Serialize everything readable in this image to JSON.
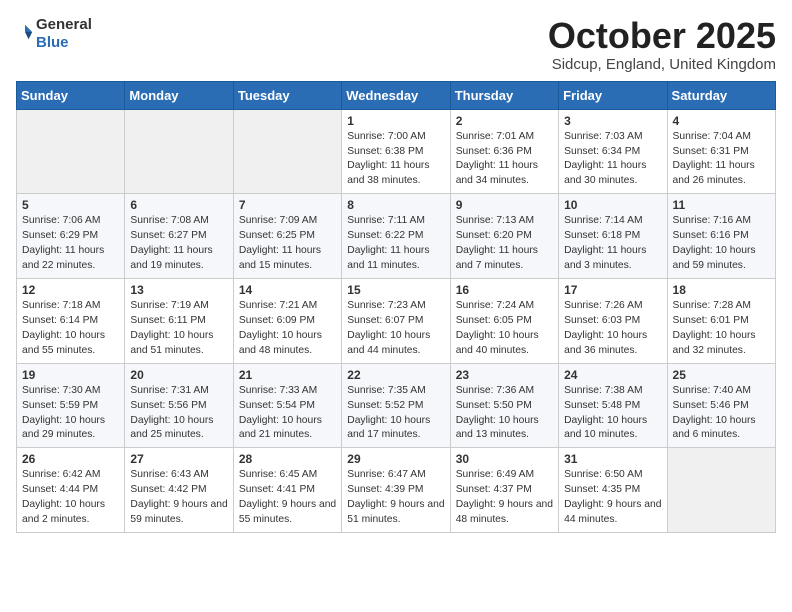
{
  "header": {
    "logo_general": "General",
    "logo_blue": "Blue",
    "month_title": "October 2025",
    "location": "Sidcup, England, United Kingdom"
  },
  "weekdays": [
    "Sunday",
    "Monday",
    "Tuesday",
    "Wednesday",
    "Thursday",
    "Friday",
    "Saturday"
  ],
  "weeks": [
    [
      {
        "day": "",
        "sunrise": "",
        "sunset": "",
        "daylight": ""
      },
      {
        "day": "",
        "sunrise": "",
        "sunset": "",
        "daylight": ""
      },
      {
        "day": "",
        "sunrise": "",
        "sunset": "",
        "daylight": ""
      },
      {
        "day": "1",
        "sunrise": "Sunrise: 7:00 AM",
        "sunset": "Sunset: 6:38 PM",
        "daylight": "Daylight: 11 hours and 38 minutes."
      },
      {
        "day": "2",
        "sunrise": "Sunrise: 7:01 AM",
        "sunset": "Sunset: 6:36 PM",
        "daylight": "Daylight: 11 hours and 34 minutes."
      },
      {
        "day": "3",
        "sunrise": "Sunrise: 7:03 AM",
        "sunset": "Sunset: 6:34 PM",
        "daylight": "Daylight: 11 hours and 30 minutes."
      },
      {
        "day": "4",
        "sunrise": "Sunrise: 7:04 AM",
        "sunset": "Sunset: 6:31 PM",
        "daylight": "Daylight: 11 hours and 26 minutes."
      }
    ],
    [
      {
        "day": "5",
        "sunrise": "Sunrise: 7:06 AM",
        "sunset": "Sunset: 6:29 PM",
        "daylight": "Daylight: 11 hours and 22 minutes."
      },
      {
        "day": "6",
        "sunrise": "Sunrise: 7:08 AM",
        "sunset": "Sunset: 6:27 PM",
        "daylight": "Daylight: 11 hours and 19 minutes."
      },
      {
        "day": "7",
        "sunrise": "Sunrise: 7:09 AM",
        "sunset": "Sunset: 6:25 PM",
        "daylight": "Daylight: 11 hours and 15 minutes."
      },
      {
        "day": "8",
        "sunrise": "Sunrise: 7:11 AM",
        "sunset": "Sunset: 6:22 PM",
        "daylight": "Daylight: 11 hours and 11 minutes."
      },
      {
        "day": "9",
        "sunrise": "Sunrise: 7:13 AM",
        "sunset": "Sunset: 6:20 PM",
        "daylight": "Daylight: 11 hours and 7 minutes."
      },
      {
        "day": "10",
        "sunrise": "Sunrise: 7:14 AM",
        "sunset": "Sunset: 6:18 PM",
        "daylight": "Daylight: 11 hours and 3 minutes."
      },
      {
        "day": "11",
        "sunrise": "Sunrise: 7:16 AM",
        "sunset": "Sunset: 6:16 PM",
        "daylight": "Daylight: 10 hours and 59 minutes."
      }
    ],
    [
      {
        "day": "12",
        "sunrise": "Sunrise: 7:18 AM",
        "sunset": "Sunset: 6:14 PM",
        "daylight": "Daylight: 10 hours and 55 minutes."
      },
      {
        "day": "13",
        "sunrise": "Sunrise: 7:19 AM",
        "sunset": "Sunset: 6:11 PM",
        "daylight": "Daylight: 10 hours and 51 minutes."
      },
      {
        "day": "14",
        "sunrise": "Sunrise: 7:21 AM",
        "sunset": "Sunset: 6:09 PM",
        "daylight": "Daylight: 10 hours and 48 minutes."
      },
      {
        "day": "15",
        "sunrise": "Sunrise: 7:23 AM",
        "sunset": "Sunset: 6:07 PM",
        "daylight": "Daylight: 10 hours and 44 minutes."
      },
      {
        "day": "16",
        "sunrise": "Sunrise: 7:24 AM",
        "sunset": "Sunset: 6:05 PM",
        "daylight": "Daylight: 10 hours and 40 minutes."
      },
      {
        "day": "17",
        "sunrise": "Sunrise: 7:26 AM",
        "sunset": "Sunset: 6:03 PM",
        "daylight": "Daylight: 10 hours and 36 minutes."
      },
      {
        "day": "18",
        "sunrise": "Sunrise: 7:28 AM",
        "sunset": "Sunset: 6:01 PM",
        "daylight": "Daylight: 10 hours and 32 minutes."
      }
    ],
    [
      {
        "day": "19",
        "sunrise": "Sunrise: 7:30 AM",
        "sunset": "Sunset: 5:59 PM",
        "daylight": "Daylight: 10 hours and 29 minutes."
      },
      {
        "day": "20",
        "sunrise": "Sunrise: 7:31 AM",
        "sunset": "Sunset: 5:56 PM",
        "daylight": "Daylight: 10 hours and 25 minutes."
      },
      {
        "day": "21",
        "sunrise": "Sunrise: 7:33 AM",
        "sunset": "Sunset: 5:54 PM",
        "daylight": "Daylight: 10 hours and 21 minutes."
      },
      {
        "day": "22",
        "sunrise": "Sunrise: 7:35 AM",
        "sunset": "Sunset: 5:52 PM",
        "daylight": "Daylight: 10 hours and 17 minutes."
      },
      {
        "day": "23",
        "sunrise": "Sunrise: 7:36 AM",
        "sunset": "Sunset: 5:50 PM",
        "daylight": "Daylight: 10 hours and 13 minutes."
      },
      {
        "day": "24",
        "sunrise": "Sunrise: 7:38 AM",
        "sunset": "Sunset: 5:48 PM",
        "daylight": "Daylight: 10 hours and 10 minutes."
      },
      {
        "day": "25",
        "sunrise": "Sunrise: 7:40 AM",
        "sunset": "Sunset: 5:46 PM",
        "daylight": "Daylight: 10 hours and 6 minutes."
      }
    ],
    [
      {
        "day": "26",
        "sunrise": "Sunrise: 6:42 AM",
        "sunset": "Sunset: 4:44 PM",
        "daylight": "Daylight: 10 hours and 2 minutes."
      },
      {
        "day": "27",
        "sunrise": "Sunrise: 6:43 AM",
        "sunset": "Sunset: 4:42 PM",
        "daylight": "Daylight: 9 hours and 59 minutes."
      },
      {
        "day": "28",
        "sunrise": "Sunrise: 6:45 AM",
        "sunset": "Sunset: 4:41 PM",
        "daylight": "Daylight: 9 hours and 55 minutes."
      },
      {
        "day": "29",
        "sunrise": "Sunrise: 6:47 AM",
        "sunset": "Sunset: 4:39 PM",
        "daylight": "Daylight: 9 hours and 51 minutes."
      },
      {
        "day": "30",
        "sunrise": "Sunrise: 6:49 AM",
        "sunset": "Sunset: 4:37 PM",
        "daylight": "Daylight: 9 hours and 48 minutes."
      },
      {
        "day": "31",
        "sunrise": "Sunrise: 6:50 AM",
        "sunset": "Sunset: 4:35 PM",
        "daylight": "Daylight: 9 hours and 44 minutes."
      },
      {
        "day": "",
        "sunrise": "",
        "sunset": "",
        "daylight": ""
      }
    ]
  ]
}
